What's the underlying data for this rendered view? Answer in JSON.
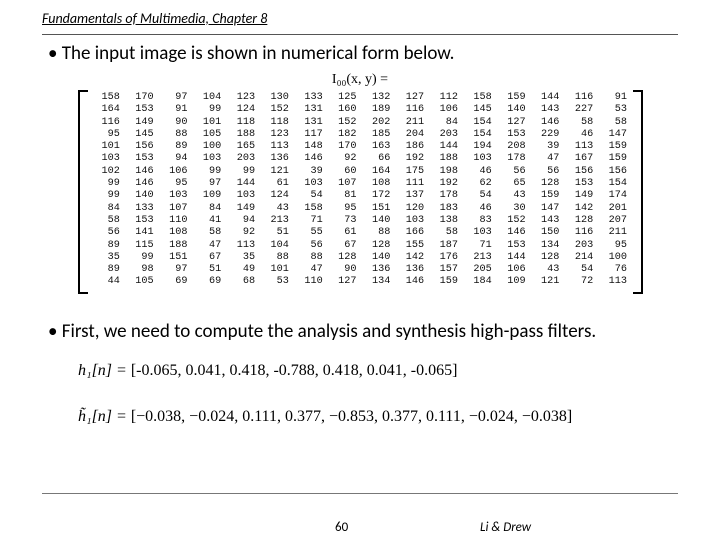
{
  "header": {
    "title": "Fundamentals of Multimedia, Chapter 8"
  },
  "bullets": {
    "b1": "• The input image is shown in numerical form below.",
    "b2": "• First, we need to compute the analysis and synthesis high-pass filters."
  },
  "ieq": "I₀₀(x, y) =",
  "matrix": [
    [
      158,
      170,
      97,
      104,
      123,
      130,
      133,
      125,
      132,
      127,
      112,
      158,
      159,
      144,
      116,
      91
    ],
    [
      164,
      153,
      91,
      99,
      124,
      152,
      131,
      160,
      189,
      116,
      106,
      145,
      140,
      143,
      227,
      53
    ],
    [
      116,
      149,
      90,
      101,
      118,
      118,
      131,
      152,
      202,
      211,
      84,
      154,
      127,
      146,
      58,
      58
    ],
    [
      95,
      145,
      88,
      105,
      188,
      123,
      117,
      182,
      185,
      204,
      203,
      154,
      153,
      229,
      46,
      147
    ],
    [
      101,
      156,
      89,
      100,
      165,
      113,
      148,
      170,
      163,
      186,
      144,
      194,
      208,
      39,
      113,
      159
    ],
    [
      103,
      153,
      94,
      103,
      203,
      136,
      146,
      92,
      66,
      192,
      188,
      103,
      178,
      47,
      167,
      159
    ],
    [
      102,
      146,
      106,
      99,
      99,
      121,
      39,
      60,
      164,
      175,
      198,
      46,
      56,
      56,
      156,
      156
    ],
    [
      99,
      146,
      95,
      97,
      144,
      61,
      103,
      107,
      108,
      111,
      192,
      62,
      65,
      128,
      153,
      154
    ],
    [
      99,
      140,
      103,
      109,
      103,
      124,
      54,
      81,
      172,
      137,
      178,
      54,
      43,
      159,
      149,
      174
    ],
    [
      84,
      133,
      107,
      84,
      149,
      43,
      158,
      95,
      151,
      120,
      183,
      46,
      30,
      147,
      142,
      201
    ],
    [
      58,
      153,
      110,
      41,
      94,
      213,
      71,
      73,
      140,
      103,
      138,
      83,
      152,
      143,
      128,
      207
    ],
    [
      56,
      141,
      108,
      58,
      92,
      51,
      55,
      61,
      88,
      166,
      58,
      103,
      146,
      150,
      116,
      211
    ],
    [
      89,
      115,
      188,
      47,
      113,
      104,
      56,
      67,
      128,
      155,
      187,
      71,
      153,
      134,
      203,
      95
    ],
    [
      35,
      99,
      151,
      67,
      35,
      88,
      88,
      128,
      140,
      142,
      176,
      213,
      144,
      128,
      214,
      100
    ],
    [
      89,
      98,
      97,
      51,
      49,
      101,
      47,
      90,
      136,
      136,
      157,
      205,
      106,
      43,
      54,
      76
    ],
    [
      44,
      105,
      69,
      69,
      68,
      53,
      110,
      127,
      134,
      146,
      159,
      184,
      109,
      121,
      72,
      113
    ]
  ],
  "filters": {
    "h1_lhs": "h₁[n] = ",
    "h1_vals": "[-0.065, 0.041, 0.418, -0.788, 0.418, 0.041, -0.065]",
    "h1t_lhs": "h̃₁[n] = ",
    "h1t_vals": "[−0.038, −0.024, 0.111, 0.377, −0.853, 0.377, 0.111, −0.024, −0.038]"
  },
  "footer": {
    "page": "60",
    "authors": "Li & Drew"
  }
}
